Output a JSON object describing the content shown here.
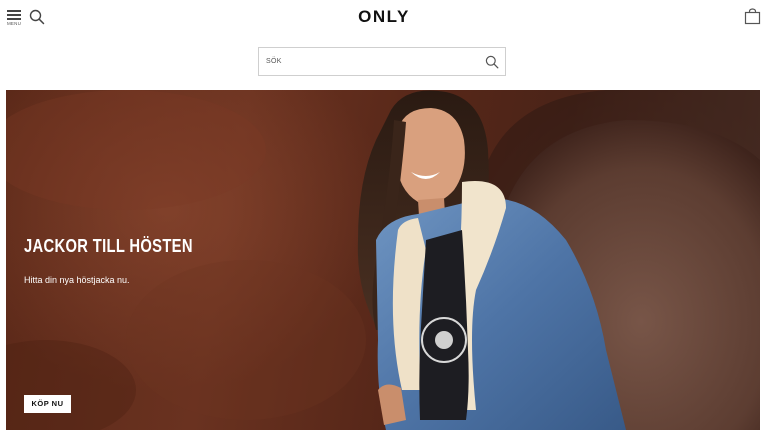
{
  "header": {
    "menu_label": "MENU",
    "logo_text": "ONLY"
  },
  "search": {
    "placeholder": "SÖK"
  },
  "hero": {
    "title": "JACKOR TILL HÖSTEN",
    "subtitle": "Hitta din nya höstjacka nu.",
    "cta_label": "KÖP NU"
  },
  "icons": {
    "menu": "hamburger-icon",
    "search": "search-icon",
    "bag": "shopping-bag-icon"
  },
  "colors": {
    "brand_text": "#111111",
    "hero_background": "#5a2818",
    "hero_text": "#ffffff"
  }
}
